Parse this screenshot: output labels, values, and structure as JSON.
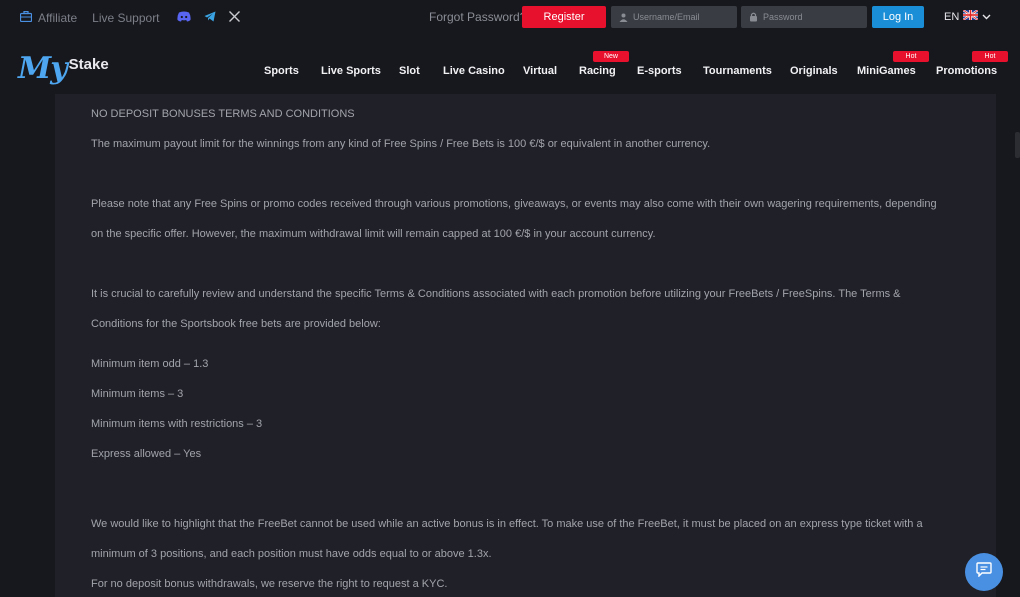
{
  "topbar": {
    "affiliate": "Affiliate",
    "live_support": "Live Support",
    "forgot_password": "Forgot Password?",
    "register": "Register",
    "username_placeholder": "Username/Email",
    "password_placeholder": "Password",
    "login": "Log In",
    "language": "EN"
  },
  "logo": {
    "my": "My",
    "stake": "Stake"
  },
  "nav": {
    "items": [
      "Sports",
      "Live Sports",
      "Slot",
      "Live Casino",
      "Virtual",
      "Racing",
      "E-sports",
      "Tournaments",
      "Originals",
      "MiniGames",
      "Promotions"
    ],
    "badges": {
      "racing": "New",
      "minigames": "Hot",
      "promotions": "Hot"
    }
  },
  "content": {
    "lines": [
      "NO DEPOSIT BONUSES TERMS AND CONDITIONS",
      "The maximum payout limit for the winnings from any kind of Free Spins / Free Bets is 100 €/$ or equivalent in another currency.",
      "Please note that any Free Spins or promo codes received through various promotions, giveaways, or events may also come with their own wagering requirements, depending",
      "on the specific offer. However, the maximum withdrawal limit will remain capped at 100 €/$ in your account currency.",
      "It is crucial to carefully review and understand the specific Terms & Conditions associated with each promotion before utilizing your FreeBets / FreeSpins. The Terms &",
      "Conditions for the Sportsbook free bets are provided below:",
      "Minimum item odd – 1.3",
      "Minimum items – 3",
      "Minimum items with restrictions – 3",
      "Express allowed – Yes",
      "We would like to highlight that the FreeBet cannot be used while an active bonus is in effect. To make use of the FreeBet, it must be placed on an express type ticket with a",
      "minimum of 3 positions, and each position must have odds equal to or above 1.3x.",
      "For no deposit bonus withdrawals, we reserve the right to request a KYC."
    ]
  },
  "colors": {
    "accent": "#1a8fd8",
    "register": "#e8112d",
    "background": "#17181d",
    "panel": "#202128"
  }
}
